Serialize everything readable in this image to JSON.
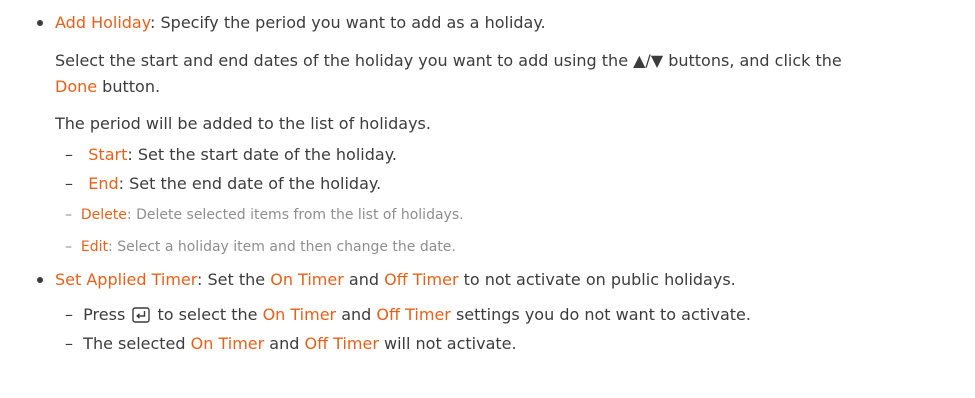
{
  "add_holiday": {
    "label": "Add Holiday",
    "desc": ": Specify the period you want to add as a holiday.",
    "p1_a": "Select the start and end dates of the holiday you want to add using the ▲/▼ buttons, and click the",
    "p1_done": "Done",
    "p1_b": " button.",
    "p2": "The period will be added to the list of holidays.",
    "start": {
      "label": "Start",
      "desc": ": Set the start date of the holiday."
    },
    "end": {
      "label": "End",
      "desc": ": Set the end date of the holiday."
    }
  },
  "delete": {
    "label": "Delete",
    "desc": ": Delete selected items from the list of holidays."
  },
  "edit": {
    "label": "Edit",
    "desc": ": Select a holiday item and then change the date."
  },
  "set_applied_timer": {
    "label": "Set Applied Timer",
    "desc_a": ": Set the ",
    "on_timer": "On Timer",
    "desc_and": " and ",
    "off_timer": "Off Timer",
    "desc_b": " to not activate on public holidays.",
    "sub1_a": "Press ",
    "sub1_b": " to select the ",
    "sub1_c": " settings you do not want to activate.",
    "sub2_a": "The selected ",
    "sub2_b": " will not activate.",
    "icon": "enter-icon"
  },
  "dash_char": "–"
}
